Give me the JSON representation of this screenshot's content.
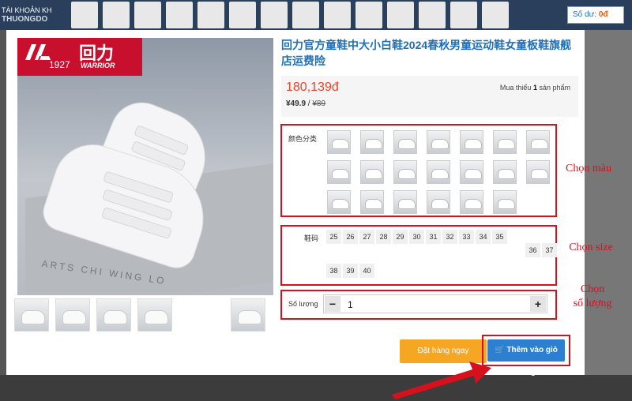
{
  "background": {
    "account_label": "TÀI KHOẢN KH",
    "brand_label": "THUONGDO",
    "balance_label": "Số dư:",
    "balance_value": "0đ"
  },
  "product": {
    "title": "回力官方童鞋中大小白鞋2024春秋男童运动鞋女童板鞋旗舰店运费险",
    "price_vnd": "180,139đ",
    "price_cny": "¥49.9",
    "price_cny_original": "¥89",
    "min_qty_prefix": "Mua thiểu",
    "min_qty_value": "1",
    "min_qty_suffix": "sản phẩm",
    "logo_year": "1927",
    "logo_cn": "回力",
    "logo_en": "WARRIOR",
    "box_text": "ARTS  CHI WING LO"
  },
  "color_section": {
    "label": "颜色分类",
    "swatch_count": 21,
    "annotation": "Chọn màu"
  },
  "size_section": {
    "label": "鞋码",
    "sizes": [
      "25",
      "26",
      "27",
      "28",
      "29",
      "30",
      "31",
      "32",
      "33",
      "34",
      "35",
      "36",
      "37",
      "38",
      "39",
      "40"
    ],
    "annotation": "Chọn size"
  },
  "quantity_section": {
    "label": "Số lượng",
    "minus": "−",
    "plus": "+",
    "value": "1",
    "annotation_line1": "Chọn",
    "annotation_line2": "số lượng"
  },
  "actions": {
    "buy_now_label": "Đặt hàng ngay",
    "add_to_cart_label": "Thêm vào giỏ hàng"
  },
  "colors": {
    "accent_blue": "#1f6fb7",
    "price_red": "#e4452e",
    "annotation_red": "#d7101d",
    "buy_orange": "#f5a623",
    "cart_blue": "#2d7fd1"
  }
}
